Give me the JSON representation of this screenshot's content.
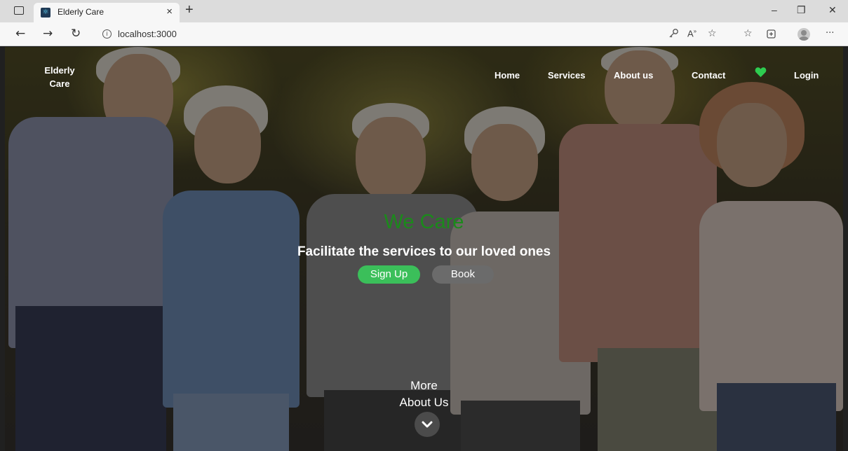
{
  "browser": {
    "tab_title": "Elderly Care",
    "tab_close": "×",
    "new_tab": "+",
    "url": "localhost:3000",
    "window_buttons": {
      "minimize": "–",
      "restore": "❐",
      "close": "✕"
    }
  },
  "nav": {
    "brand_line1": "Elderly",
    "brand_line2": "Care",
    "links": {
      "home": "Home",
      "services": "Services",
      "about": "About us",
      "contact": "Contact",
      "login": "Login"
    }
  },
  "hero": {
    "title": "We Care",
    "subtitle": "Facilitate the services to our loved ones",
    "signup_label": "Sign Up",
    "book_label": "Book",
    "more_line1": "More",
    "more_line2": "About Us"
  },
  "colors": {
    "accent_green": "#3bbf5a",
    "title_green": "#1b8a1b",
    "heart_green": "#2ecc50",
    "book_gray": "#6b6b6b"
  }
}
